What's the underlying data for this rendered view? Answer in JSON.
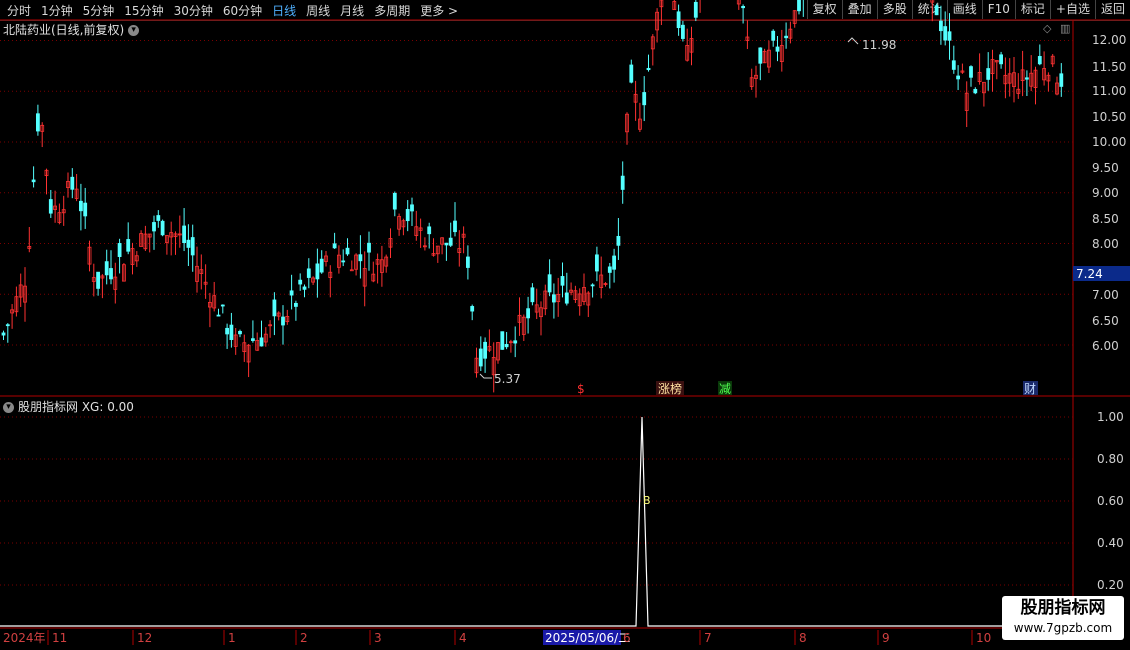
{
  "toolbar": {
    "periods": [
      "分时",
      "1分钟",
      "5分钟",
      "15分钟",
      "30分钟",
      "60分钟",
      "日线",
      "周线",
      "月线",
      "多周期",
      "更多 >"
    ],
    "active": "日线",
    "actions": [
      "复权",
      "叠加",
      "多股",
      "统计",
      "画线",
      "F10",
      "标记",
      "+自选",
      "返回"
    ]
  },
  "main_title": "北陆药业(日线,前复权)",
  "indicator_title": "股朋指标网 XG: 0.00",
  "price_axis": [
    "12.00",
    "11.50",
    "11.00",
    "10.50",
    "10.00",
    "9.50",
    "9.00",
    "8.50",
    "8.00",
    "7.00",
    "6.50",
    "6.00"
  ],
  "current_price": "7.24",
  "high_label": "11.98",
  "low_label": "5.37",
  "ind_axis": [
    "1.00",
    "0.80",
    "0.60",
    "0.40",
    "0.20"
  ],
  "ind_marker": "B",
  "events": [
    "$",
    "涨榜",
    "减",
    "财"
  ],
  "date_axis": [
    "2024年",
    "11",
    "12",
    "1",
    "2",
    "3",
    "4",
    "2025/05/06/二",
    "6",
    "7",
    "8",
    "9",
    "10"
  ],
  "watermark": {
    "line1": "股朋指标网",
    "line2": "www.7gpzb.com"
  },
  "colors": {
    "up": "#ff3232",
    "down": "#54ffff",
    "grid": "#8b0000",
    "axis": "#b00000"
  }
}
